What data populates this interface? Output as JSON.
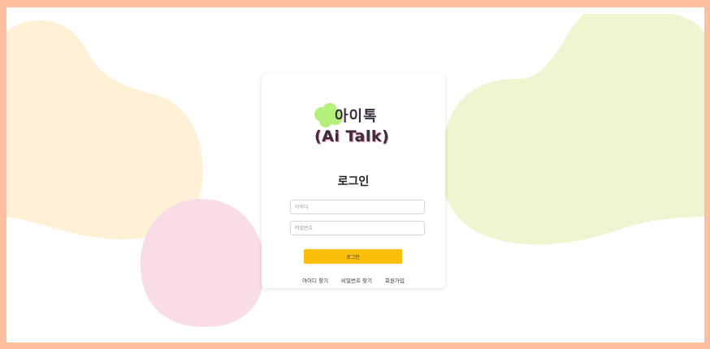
{
  "logo": {
    "line1": "아이톡",
    "line2": "(Ai Talk)"
  },
  "form": {
    "title": "로그인",
    "id_placeholder": "아이디",
    "password_placeholder": "비밀번호",
    "login_label": "로그인"
  },
  "links": {
    "find_id": "아이디 찾기",
    "find_password": "비밀번호 찾기",
    "signup": "회원가입"
  },
  "colors": {
    "border": "#ffbf9e",
    "blob_left": "#fff0d6",
    "blob_pink": "#f9dde6",
    "blob_right": "#eef5d0",
    "button": "#fbbf0b",
    "logo_bubble": "#b6f07c"
  }
}
